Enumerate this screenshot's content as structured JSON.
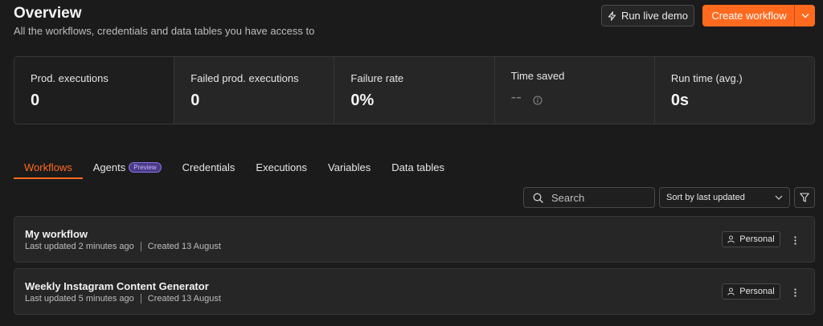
{
  "header": {
    "title": "Overview",
    "subtitle": "All the workflows, credentials and data tables you have access to"
  },
  "actions": {
    "run_demo_label": "Run live demo",
    "create_label": "Create workflow"
  },
  "stats": [
    {
      "label": "Prod. executions",
      "value": "0"
    },
    {
      "label": "Failed prod. executions",
      "value": "0"
    },
    {
      "label": "Failure rate",
      "value": "0%"
    },
    {
      "label": "Time saved",
      "value": "--"
    },
    {
      "label": "Run time (avg.)",
      "value": "0s"
    }
  ],
  "tabs": [
    {
      "label": "Workflows",
      "active": true
    },
    {
      "label": "Agents",
      "badge": "Preview"
    },
    {
      "label": "Credentials"
    },
    {
      "label": "Executions"
    },
    {
      "label": "Variables"
    },
    {
      "label": "Data tables"
    }
  ],
  "toolbar": {
    "search_placeholder": "Search",
    "sort_value": "Sort by last updated"
  },
  "workflows": [
    {
      "name": "My workflow",
      "updated": "Last updated 2 minutes ago",
      "created": "Created 13 August",
      "owner": "Personal"
    },
    {
      "name": "Weekly Instagram Content Generator",
      "updated": "Last updated 5 minutes ago",
      "created": "Created 13 August",
      "owner": "Personal"
    }
  ],
  "colors": {
    "accent": "#ff6a1f",
    "background": "#1b1b1b",
    "card": "#262626",
    "badge": "#4b3b86"
  },
  "icons": {
    "run_demo": "lightning-icon",
    "create_split": "chevron-down-icon",
    "time_saved_info": "info-icon",
    "search": "search-icon",
    "sort": "chevron-down-icon",
    "filter": "filter-icon",
    "owner": "user-icon",
    "card_menu": "vertical-dots-icon"
  }
}
